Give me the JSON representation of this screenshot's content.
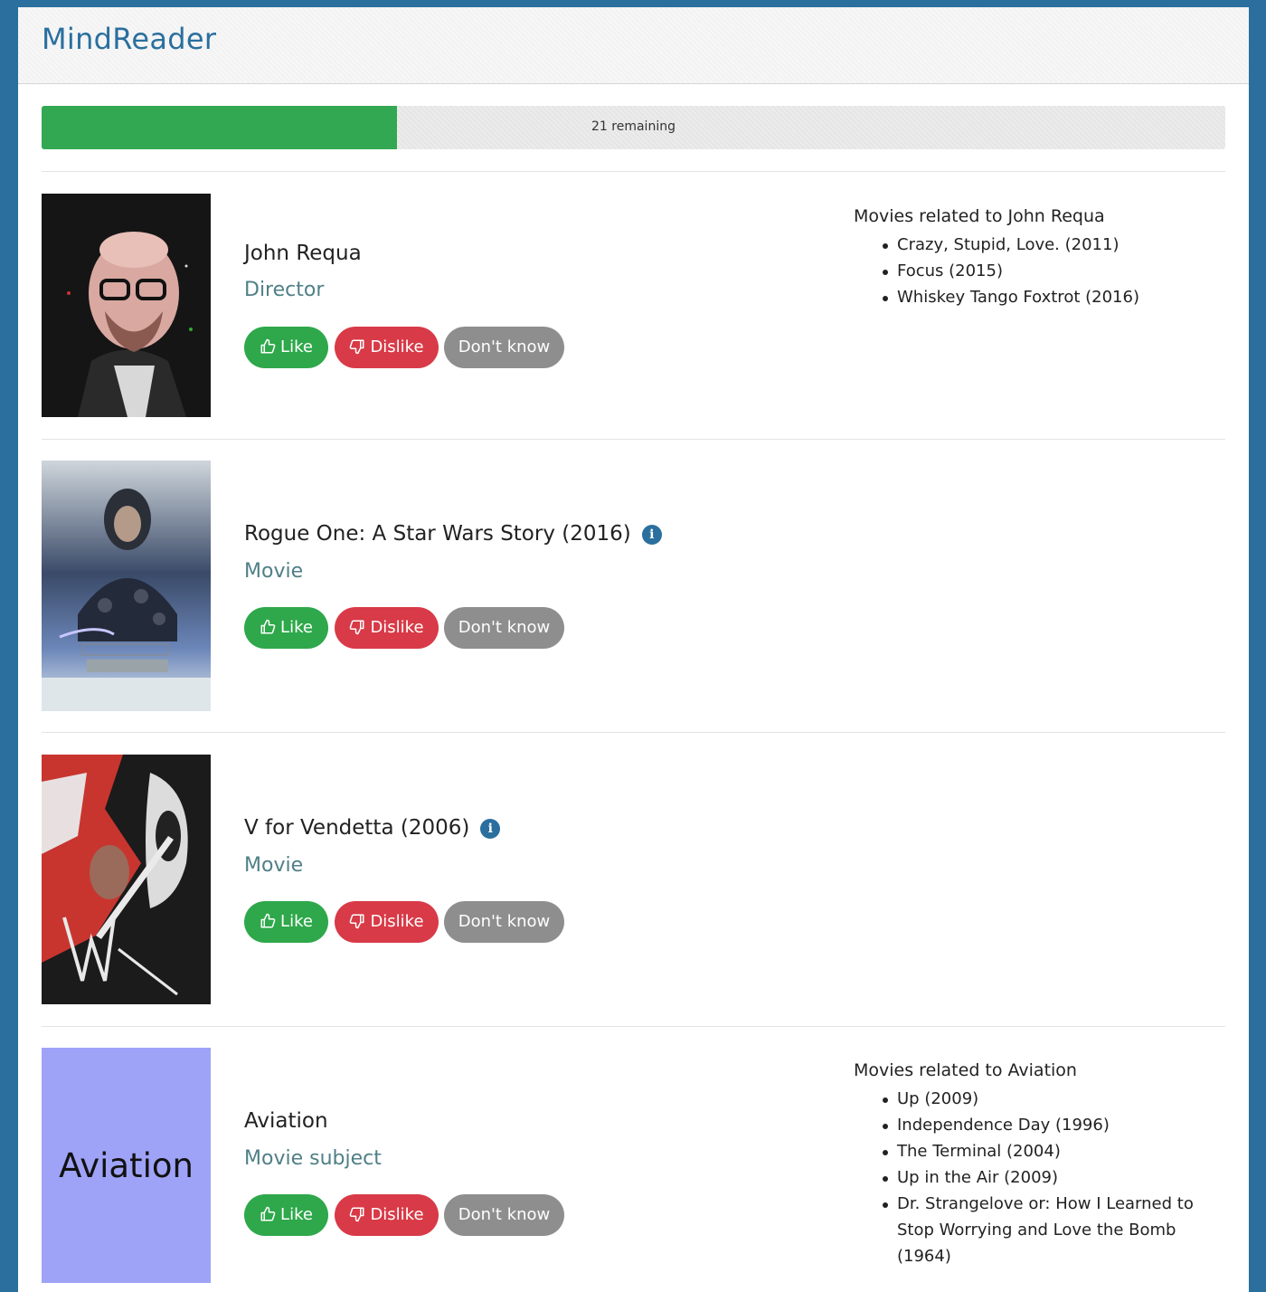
{
  "app": {
    "brand": "MindReader"
  },
  "progress": {
    "label": "21 remaining",
    "fraction": 0.3
  },
  "buttons": {
    "like": "Like",
    "dislike": "Dislike",
    "dont_know": "Don't know"
  },
  "entries": [
    {
      "title": "John Requa",
      "type": "Director",
      "image": "John Requa portrait photo",
      "related_title": "Movies related to John Requa",
      "related": [
        "Crazy, Stupid, Love. (2011)",
        "Focus (2015)",
        "Whiskey Tango Foxtrot (2016)"
      ]
    },
    {
      "title": "Rogue One: A Star Wars Story (2016)",
      "type": "Movie",
      "image": "Rogue One poster",
      "has_info": true
    },
    {
      "title": "V for Vendetta (2006)",
      "type": "Movie",
      "image": "V for Vendetta poster",
      "has_info": true
    },
    {
      "title": "Aviation",
      "type": "Movie subject",
      "image_text": "Aviation",
      "image_color": "#9ea3f7",
      "related_title": "Movies related to Aviation",
      "related": [
        "Up (2009)",
        "Independence Day (1996)",
        "The Terminal (2004)",
        "Up in the Air (2009)",
        "Dr. Strangelove or: How I Learned to Stop Worrying and Love the Bomb (1964)"
      ]
    }
  ],
  "icons": {
    "info": "info-circle-icon",
    "like": "thumbs-up-icon",
    "dislike": "thumbs-down-icon"
  }
}
